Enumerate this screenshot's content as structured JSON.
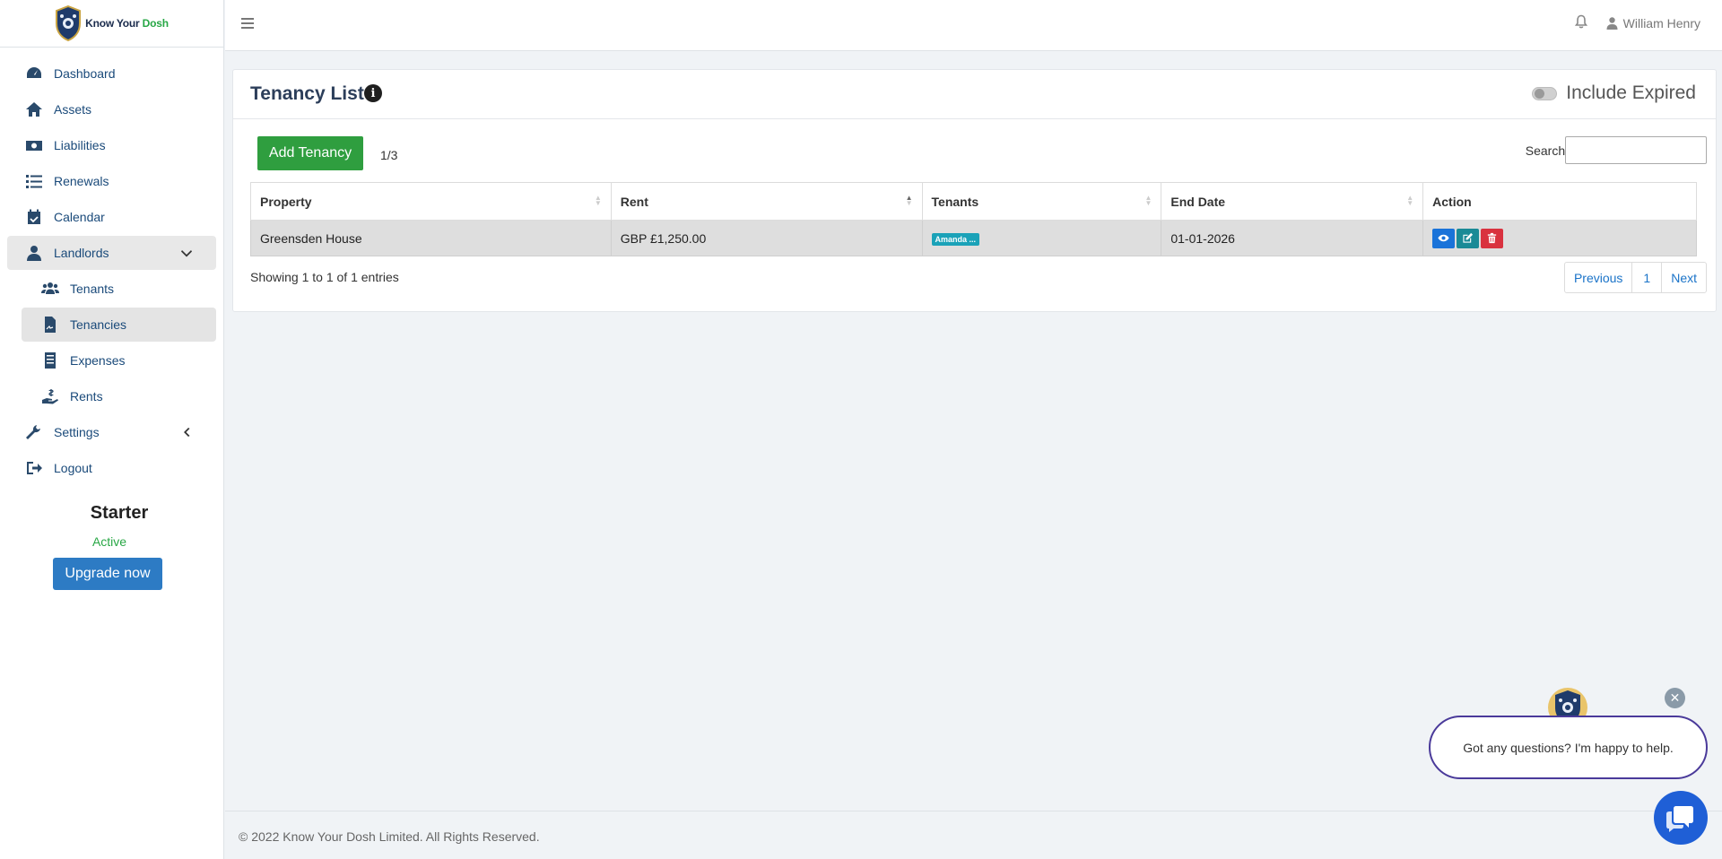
{
  "brand": {
    "name_part1": "Know Your ",
    "name_part2": "Dosh"
  },
  "colors": {
    "accent": "#2d7bc4",
    "success": "#2f9e3f",
    "info": "#1aa2b8",
    "danger": "#d9323f",
    "chat": "#4a3a9a"
  },
  "sidebar": {
    "items": [
      {
        "label": "Dashboard",
        "icon": "gauge-icon"
      },
      {
        "label": "Assets",
        "icon": "home-icon"
      },
      {
        "label": "Liabilities",
        "icon": "money-icon"
      },
      {
        "label": "Renewals",
        "icon": "list-icon"
      },
      {
        "label": "Calendar",
        "icon": "calendar-check-icon"
      },
      {
        "label": "Landlords",
        "icon": "user-tie-icon",
        "expanded": true
      },
      {
        "label": "Tenants",
        "icon": "users-icon"
      },
      {
        "label": "Tenancies",
        "icon": "file-contract-icon",
        "active": true
      },
      {
        "label": "Expenses",
        "icon": "receipt-icon"
      },
      {
        "label": "Rents",
        "icon": "hand-holding-dollar-icon"
      },
      {
        "label": "Settings",
        "icon": "wrench-icon"
      },
      {
        "label": "Logout",
        "icon": "sign-out-icon"
      }
    ],
    "plan": {
      "name": "Starter",
      "status": "Active",
      "upgrade_label": "Upgrade now"
    }
  },
  "topbar": {
    "user_name": "William Henry"
  },
  "tenancy": {
    "title": "Tenancy List",
    "include_expired_label": "Include Expired",
    "add_label": "Add Tenancy",
    "count": "1/3",
    "search_label": "Search:",
    "columns": [
      "Property",
      "Rent",
      "Tenants",
      "End Date",
      "Action"
    ],
    "rows": [
      {
        "property": "Greensden House",
        "rent": "GBP £1,250.00",
        "tenants": "Amanda ...",
        "end_date": "01-01-2026"
      }
    ],
    "showing": "Showing 1 to 1 of 1 entries",
    "pager": {
      "previous": "Previous",
      "page": "1",
      "next": "Next"
    }
  },
  "footer": {
    "text": "© 2022 Know Your Dosh Limited. All Rights Reserved."
  },
  "chat": {
    "message": "Got any questions? I'm happy to help."
  }
}
